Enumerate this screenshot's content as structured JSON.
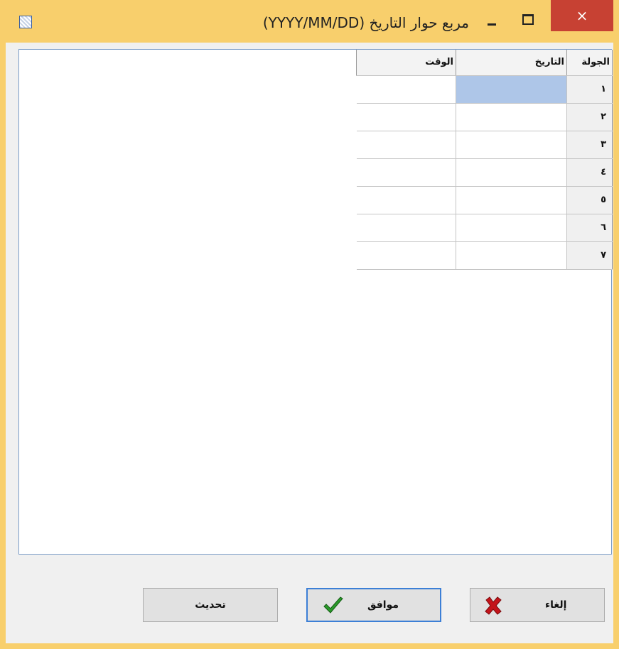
{
  "window": {
    "title": "مربع حوار التاريخ (YYYY/MM/DD)",
    "controls": {
      "minimize": "–",
      "maximize": "□",
      "close": "×"
    }
  },
  "grid": {
    "columns": [
      "الجولة",
      "التاريخ",
      "الوقت"
    ],
    "rows": [
      {
        "num": "١",
        "date": "",
        "time": ""
      },
      {
        "num": "٢",
        "date": "",
        "time": ""
      },
      {
        "num": "٣",
        "date": "",
        "time": ""
      },
      {
        "num": "٤",
        "date": "",
        "time": ""
      },
      {
        "num": "٥",
        "date": "",
        "time": ""
      },
      {
        "num": "٦",
        "date": "",
        "time": ""
      },
      {
        "num": "٧",
        "date": "",
        "time": ""
      }
    ],
    "selected_cell_color": "#aec6e8"
  },
  "buttons": {
    "update": "تحديث",
    "ok": "موافق",
    "cancel": "إلغاء"
  },
  "icons": {
    "app": "calendar-grid-icon",
    "ok": "green-checkmark-icon",
    "cancel": "red-x-icon"
  },
  "colors": {
    "frame": "#f8cf6c",
    "close_button": "#c74133",
    "focus_border": "#3c7fd6"
  }
}
